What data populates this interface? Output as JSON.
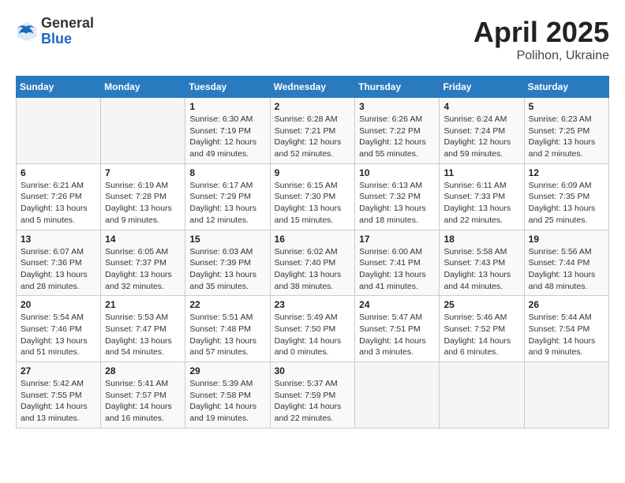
{
  "header": {
    "logo": {
      "general": "General",
      "blue": "Blue"
    },
    "title": "April 2025",
    "location": "Polihon, Ukraine"
  },
  "weekdays": [
    "Sunday",
    "Monday",
    "Tuesday",
    "Wednesday",
    "Thursday",
    "Friday",
    "Saturday"
  ],
  "weeks": [
    [
      null,
      null,
      {
        "day": 1,
        "sunrise": "6:30 AM",
        "sunset": "7:19 PM",
        "daylight": "12 hours and 49 minutes."
      },
      {
        "day": 2,
        "sunrise": "6:28 AM",
        "sunset": "7:21 PM",
        "daylight": "12 hours and 52 minutes."
      },
      {
        "day": 3,
        "sunrise": "6:26 AM",
        "sunset": "7:22 PM",
        "daylight": "12 hours and 55 minutes."
      },
      {
        "day": 4,
        "sunrise": "6:24 AM",
        "sunset": "7:24 PM",
        "daylight": "12 hours and 59 minutes."
      },
      {
        "day": 5,
        "sunrise": "6:23 AM",
        "sunset": "7:25 PM",
        "daylight": "13 hours and 2 minutes."
      }
    ],
    [
      {
        "day": 6,
        "sunrise": "6:21 AM",
        "sunset": "7:26 PM",
        "daylight": "13 hours and 5 minutes."
      },
      {
        "day": 7,
        "sunrise": "6:19 AM",
        "sunset": "7:28 PM",
        "daylight": "13 hours and 9 minutes."
      },
      {
        "day": 8,
        "sunrise": "6:17 AM",
        "sunset": "7:29 PM",
        "daylight": "13 hours and 12 minutes."
      },
      {
        "day": 9,
        "sunrise": "6:15 AM",
        "sunset": "7:30 PM",
        "daylight": "13 hours and 15 minutes."
      },
      {
        "day": 10,
        "sunrise": "6:13 AM",
        "sunset": "7:32 PM",
        "daylight": "13 hours and 18 minutes."
      },
      {
        "day": 11,
        "sunrise": "6:11 AM",
        "sunset": "7:33 PM",
        "daylight": "13 hours and 22 minutes."
      },
      {
        "day": 12,
        "sunrise": "6:09 AM",
        "sunset": "7:35 PM",
        "daylight": "13 hours and 25 minutes."
      }
    ],
    [
      {
        "day": 13,
        "sunrise": "6:07 AM",
        "sunset": "7:36 PM",
        "daylight": "13 hours and 28 minutes."
      },
      {
        "day": 14,
        "sunrise": "6:05 AM",
        "sunset": "7:37 PM",
        "daylight": "13 hours and 32 minutes."
      },
      {
        "day": 15,
        "sunrise": "6:03 AM",
        "sunset": "7:39 PM",
        "daylight": "13 hours and 35 minutes."
      },
      {
        "day": 16,
        "sunrise": "6:02 AM",
        "sunset": "7:40 PM",
        "daylight": "13 hours and 38 minutes."
      },
      {
        "day": 17,
        "sunrise": "6:00 AM",
        "sunset": "7:41 PM",
        "daylight": "13 hours and 41 minutes."
      },
      {
        "day": 18,
        "sunrise": "5:58 AM",
        "sunset": "7:43 PM",
        "daylight": "13 hours and 44 minutes."
      },
      {
        "day": 19,
        "sunrise": "5:56 AM",
        "sunset": "7:44 PM",
        "daylight": "13 hours and 48 minutes."
      }
    ],
    [
      {
        "day": 20,
        "sunrise": "5:54 AM",
        "sunset": "7:46 PM",
        "daylight": "13 hours and 51 minutes."
      },
      {
        "day": 21,
        "sunrise": "5:53 AM",
        "sunset": "7:47 PM",
        "daylight": "13 hours and 54 minutes."
      },
      {
        "day": 22,
        "sunrise": "5:51 AM",
        "sunset": "7:48 PM",
        "daylight": "13 hours and 57 minutes."
      },
      {
        "day": 23,
        "sunrise": "5:49 AM",
        "sunset": "7:50 PM",
        "daylight": "14 hours and 0 minutes."
      },
      {
        "day": 24,
        "sunrise": "5:47 AM",
        "sunset": "7:51 PM",
        "daylight": "14 hours and 3 minutes."
      },
      {
        "day": 25,
        "sunrise": "5:46 AM",
        "sunset": "7:52 PM",
        "daylight": "14 hours and 6 minutes."
      },
      {
        "day": 26,
        "sunrise": "5:44 AM",
        "sunset": "7:54 PM",
        "daylight": "14 hours and 9 minutes."
      }
    ],
    [
      {
        "day": 27,
        "sunrise": "5:42 AM",
        "sunset": "7:55 PM",
        "daylight": "14 hours and 13 minutes."
      },
      {
        "day": 28,
        "sunrise": "5:41 AM",
        "sunset": "7:57 PM",
        "daylight": "14 hours and 16 minutes."
      },
      {
        "day": 29,
        "sunrise": "5:39 AM",
        "sunset": "7:58 PM",
        "daylight": "14 hours and 19 minutes."
      },
      {
        "day": 30,
        "sunrise": "5:37 AM",
        "sunset": "7:59 PM",
        "daylight": "14 hours and 22 minutes."
      },
      null,
      null,
      null
    ]
  ]
}
